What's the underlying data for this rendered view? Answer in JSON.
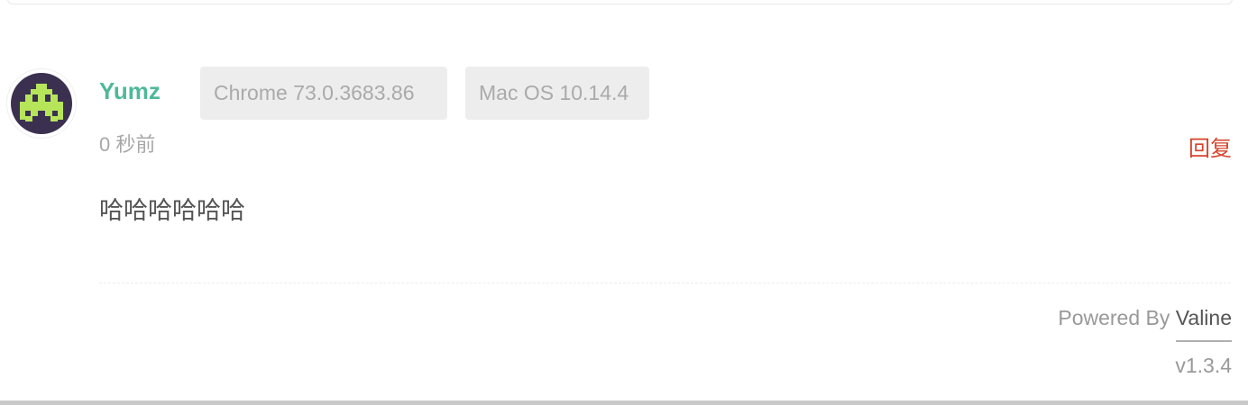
{
  "comment": {
    "author": "Yumz",
    "browser": "Chrome 73.0.3683.86",
    "os": "Mac OS 10.14.4",
    "time": "0 秒前",
    "reply_label": "回复",
    "content": "哈哈哈哈哈哈",
    "avatar_icon": "space-invader-icon",
    "colors": {
      "author": "#4fb89a",
      "reply": "#d6432b",
      "avatar_bg": "#3b3050",
      "avatar_fg": "#b6e55a"
    }
  },
  "footer": {
    "powered_prefix": "Powered By",
    "powered_link": "Valine",
    "version": "v1.3.4"
  }
}
